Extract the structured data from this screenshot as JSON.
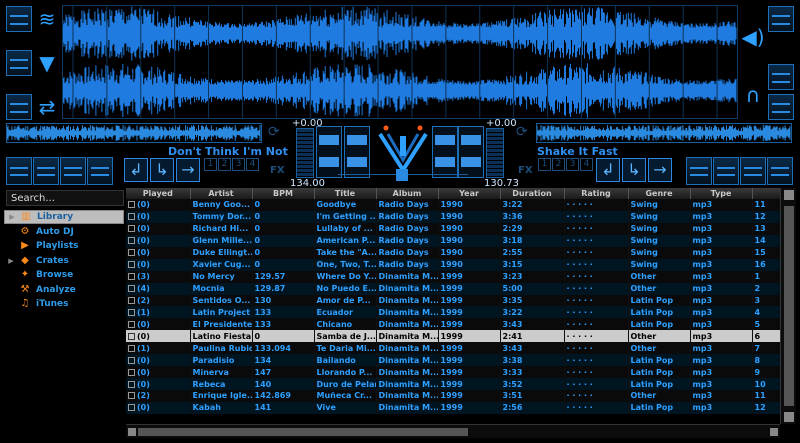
{
  "decks": {
    "left": {
      "title": "Don't Think I'm Not",
      "pitch": "+0.00",
      "bpm": "134.00"
    },
    "right": {
      "title": "Shake It Fast",
      "pitch": "+0.00",
      "bpm": "130.73"
    }
  },
  "labels": {
    "fx": "FX",
    "hotcues": [
      "1",
      "2",
      "3",
      "4"
    ]
  },
  "sidebar": {
    "search_value": "Search...",
    "items": [
      {
        "label": "Library",
        "icon": "library-icon",
        "has_arrow": true
      },
      {
        "label": "Auto DJ",
        "icon": "autodj-icon",
        "has_arrow": false
      },
      {
        "label": "Playlists",
        "icon": "playlists-icon",
        "has_arrow": false
      },
      {
        "label": "Crates",
        "icon": "crates-icon",
        "has_arrow": true
      },
      {
        "label": "Browse",
        "icon": "browse-icon",
        "has_arrow": false
      },
      {
        "label": "Analyze",
        "icon": "analyze-icon",
        "has_arrow": false
      },
      {
        "label": "iTunes",
        "icon": "itunes-icon",
        "has_arrow": false
      }
    ]
  },
  "table": {
    "columns": [
      "Played",
      "Artist",
      "BPM",
      "Title",
      "Album",
      "Year",
      "Duration",
      "Rating",
      "Genre",
      "Type",
      ""
    ],
    "rows": [
      [
        "(0)",
        "Benny Goo...",
        "0",
        "Goodbye",
        "Radio Days",
        "1990",
        "3:22",
        "· · · · ·",
        "Swing",
        "mp3",
        "11"
      ],
      [
        "(0)",
        "Tommy Dor...",
        "0",
        "I'm Getting ...",
        "Radio Days",
        "1990",
        "3:36",
        "· · · · ·",
        "Swing",
        "mp3",
        "12"
      ],
      [
        "(0)",
        "Richard Hi...",
        "0",
        "Lullaby of ...",
        "Radio Days",
        "1990",
        "2:29",
        "· · · · ·",
        "Swing",
        "mp3",
        "13"
      ],
      [
        "(0)",
        "Glenn Mille...",
        "0",
        "American P...",
        "Radio Days",
        "1990",
        "3:18",
        "· · · · ·",
        "Swing",
        "mp3",
        "14"
      ],
      [
        "(0)",
        "Duke Ellingt...",
        "0",
        "Take the \"A...",
        "Radio Days",
        "1990",
        "2:55",
        "· · · · ·",
        "Swing",
        "mp3",
        "15"
      ],
      [
        "(0)",
        "Xavier Cug...",
        "0",
        "One, Two, T...",
        "Radio Days",
        "1990",
        "3:15",
        "· · · · ·",
        "Swing",
        "mp3",
        "16"
      ],
      [
        "(3)",
        "No Mercy",
        "129.57",
        "Where Do Y...",
        "Dinamita M...",
        "1999",
        "3:23",
        "· · · · ·",
        "Other",
        "mp3",
        "1"
      ],
      [
        "(4)",
        "Mocnia",
        "129.87",
        "No Puedo E...",
        "Dinamita M...",
        "1999",
        "5:00",
        "· · · · ·",
        "Other",
        "mp3",
        "2"
      ],
      [
        "(2)",
        "Sentidos O...",
        "130",
        "Amor de P...",
        "Dinamita M...",
        "1999",
        "3:35",
        "· · · · ·",
        "Latin Pop",
        "mp3",
        "3"
      ],
      [
        "(1)",
        "Latin Project",
        "133",
        "Ecuador",
        "Dinamita M...",
        "1999",
        "3:22",
        "· · · · ·",
        "Latin Pop",
        "mp3",
        "4"
      ],
      [
        "(0)",
        "El Presidente",
        "133",
        "Chicano",
        "Dinamita M...",
        "1999",
        "3:43",
        "· · · · ·",
        "Latin Pop",
        "mp3",
        "5"
      ],
      [
        "(0)",
        "Latino Fiesta",
        "0",
        "Samba de J...",
        "Dinamita M...",
        "1999",
        "2:41",
        "· · · · ·",
        "Other",
        "mp3",
        "6"
      ],
      [
        "(1)",
        "Paulina Rubio",
        "133.094",
        "Te Daria Mi...",
        "Dinamita M...",
        "1999",
        "3:43",
        "· · · · ·",
        "Other",
        "mp3",
        "7"
      ],
      [
        "(0)",
        "Paradisio",
        "134",
        "Bailando",
        "Dinamita M...",
        "1999",
        "3:38",
        "· · · · ·",
        "Latin Pop",
        "mp3",
        "8"
      ],
      [
        "(0)",
        "Minerva",
        "147",
        "Llorando P...",
        "Dinamita M...",
        "1999",
        "3:33",
        "· · · · ·",
        "Latin Pop",
        "mp3",
        "9"
      ],
      [
        "(0)",
        "Rebeca",
        "140",
        "Duro de Pelar",
        "Dinamita M...",
        "1999",
        "3:52",
        "· · · · ·",
        "Latin Pop",
        "mp3",
        "10"
      ],
      [
        "(2)",
        "Enrique Igle...",
        "142.869",
        "Muñeca Cr...",
        "Dinamita M...",
        "1999",
        "3:51",
        "· · · · ·",
        "Other",
        "mp3",
        "11"
      ],
      [
        "(0)",
        "Kabah",
        "141",
        "Vive",
        "Dinamita M...",
        "1999",
        "2:56",
        "· · · · ·",
        "Latin Pop",
        "mp3",
        "12"
      ]
    ],
    "selected_row": 11
  },
  "colors": {
    "accent": "#2ea0ff",
    "highlight": "#cccccc",
    "orange": "#ff8a1a"
  }
}
